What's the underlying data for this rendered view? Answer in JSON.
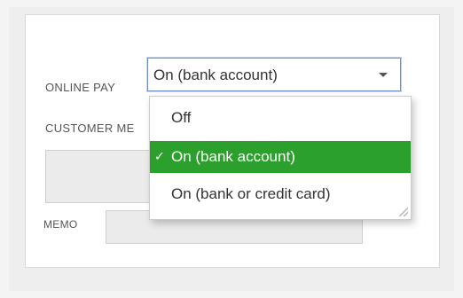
{
  "form": {
    "online_pay_label": "ONLINE PAY",
    "customer_memo_label": "CUSTOMER ME",
    "memo_label": "MEMO"
  },
  "online_pay_select": {
    "selected_value": "On (bank account)",
    "options": [
      {
        "label": "Off",
        "selected": false
      },
      {
        "label": "On (bank account)",
        "selected": true
      },
      {
        "label": "On (bank or credit card)",
        "selected": false
      }
    ],
    "check_glyph": "✓",
    "highlight_color": "#2ca02c"
  }
}
